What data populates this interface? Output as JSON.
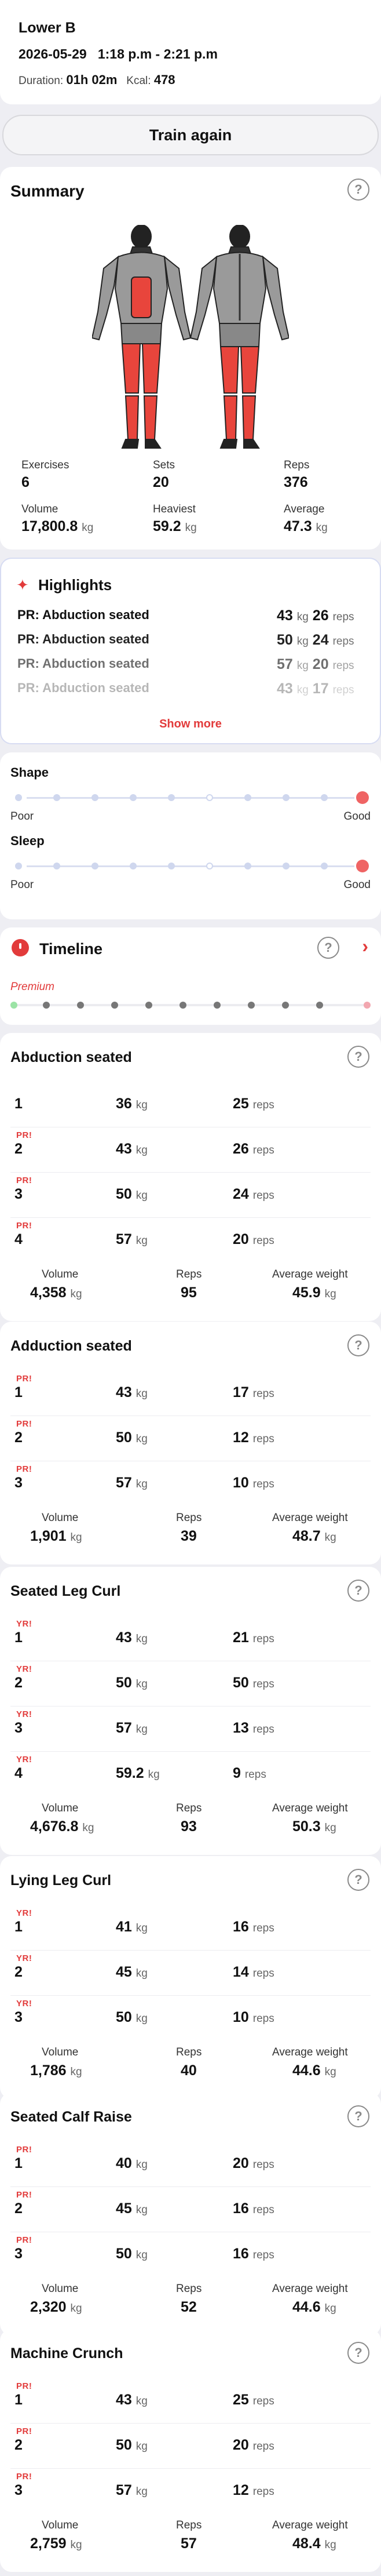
{
  "header": {
    "title": "Lower B",
    "date": "2026-05-29",
    "time": "1:18 p.m - 2:21 p.m",
    "duration_label": "Duration:",
    "duration_value": "01h 02m",
    "kcal_label": "Kcal:",
    "kcal_value": "478"
  },
  "train_again_label": "Train again",
  "summary": {
    "title": "Summary",
    "stats": [
      {
        "label": "Exercises",
        "value": "6",
        "unit": ""
      },
      {
        "label": "Sets",
        "value": "20",
        "unit": ""
      },
      {
        "label": "Reps",
        "value": "376",
        "unit": ""
      },
      {
        "label": "Volume",
        "value": "17,800.8",
        "unit": "kg"
      },
      {
        "label": "Heaviest",
        "value": "59.2",
        "unit": "kg"
      },
      {
        "label": "Average",
        "value": "47.3",
        "unit": "kg"
      }
    ]
  },
  "highlights": {
    "title": "Highlights",
    "items": [
      {
        "label": "PR: Abduction seated",
        "weight": "43",
        "reps": "26"
      },
      {
        "label": "PR: Abduction seated",
        "weight": "50",
        "reps": "24"
      },
      {
        "label": "PR: Abduction seated",
        "weight": "57",
        "reps": "20"
      },
      {
        "label": "PR: Abduction seated",
        "weight": "43",
        "reps": "17"
      }
    ],
    "unit_kg": "kg",
    "unit_reps": "reps",
    "show_more": "Show more"
  },
  "ratings": {
    "shape_label": "Shape",
    "shape_level": 1.0,
    "sleep_label": "Sleep",
    "sleep_level": 1.0,
    "poor": "Poor",
    "good": "Good"
  },
  "timeline": {
    "title": "Timeline",
    "premium": "Premium"
  },
  "exercises": [
    {
      "name": "Abduction seated",
      "sets": [
        {
          "n": "1",
          "pr": "",
          "w": "36",
          "r": "25"
        },
        {
          "n": "2",
          "pr": "PR!",
          "w": "43",
          "r": "26"
        },
        {
          "n": "3",
          "pr": "PR!",
          "w": "50",
          "r": "24"
        },
        {
          "n": "4",
          "pr": "PR!",
          "w": "57",
          "r": "20"
        }
      ],
      "volume": "4,358",
      "reps": "95",
      "avg": "45.9"
    },
    {
      "name": "Adduction seated",
      "sets": [
        {
          "n": "1",
          "pr": "PR!",
          "w": "43",
          "r": "17"
        },
        {
          "n": "2",
          "pr": "PR!",
          "w": "50",
          "r": "12"
        },
        {
          "n": "3",
          "pr": "PR!",
          "w": "57",
          "r": "10"
        }
      ],
      "volume": "1,901",
      "reps": "39",
      "avg": "48.7"
    },
    {
      "name": "Seated Leg Curl",
      "sets": [
        {
          "n": "1",
          "pr": "YR!",
          "w": "43",
          "r": "21"
        },
        {
          "n": "2",
          "pr": "YR!",
          "w": "50",
          "r": "50"
        },
        {
          "n": "3",
          "pr": "YR!",
          "w": "57",
          "r": "13"
        },
        {
          "n": "4",
          "pr": "YR!",
          "w": "59.2",
          "r": "9"
        }
      ],
      "volume": "4,676.8",
      "reps": "93",
      "avg": "50.3"
    },
    {
      "name": "Lying Leg Curl",
      "sets": [
        {
          "n": "1",
          "pr": "YR!",
          "w": "41",
          "r": "16"
        },
        {
          "n": "2",
          "pr": "YR!",
          "w": "45",
          "r": "14"
        },
        {
          "n": "3",
          "pr": "YR!",
          "w": "50",
          "r": "10"
        }
      ],
      "volume": "1,786",
      "reps": "40",
      "avg": "44.6"
    },
    {
      "name": "Seated Calf Raise",
      "sets": [
        {
          "n": "1",
          "pr": "PR!",
          "w": "40",
          "r": "20"
        },
        {
          "n": "2",
          "pr": "PR!",
          "w": "45",
          "r": "16"
        },
        {
          "n": "3",
          "pr": "PR!",
          "w": "50",
          "r": "16"
        }
      ],
      "volume": "2,320",
      "reps": "52",
      "avg": "44.6"
    },
    {
      "name": "Machine Crunch",
      "sets": [
        {
          "n": "1",
          "pr": "PR!",
          "w": "43",
          "r": "25"
        },
        {
          "n": "2",
          "pr": "PR!",
          "w": "50",
          "r": "20"
        },
        {
          "n": "3",
          "pr": "PR!",
          "w": "57",
          "r": "12"
        }
      ],
      "volume": "2,759",
      "reps": "57",
      "avg": "48.4"
    }
  ],
  "labels": {
    "volume": "Volume",
    "reps": "Reps",
    "avg_weight": "Average weight",
    "kg": "kg",
    "reps_unit": "reps",
    "help": "?"
  },
  "colors": {
    "accent_red": "#e23b3b",
    "good_dot": "#ef6464",
    "muscle_highlight": "#e8453c"
  }
}
